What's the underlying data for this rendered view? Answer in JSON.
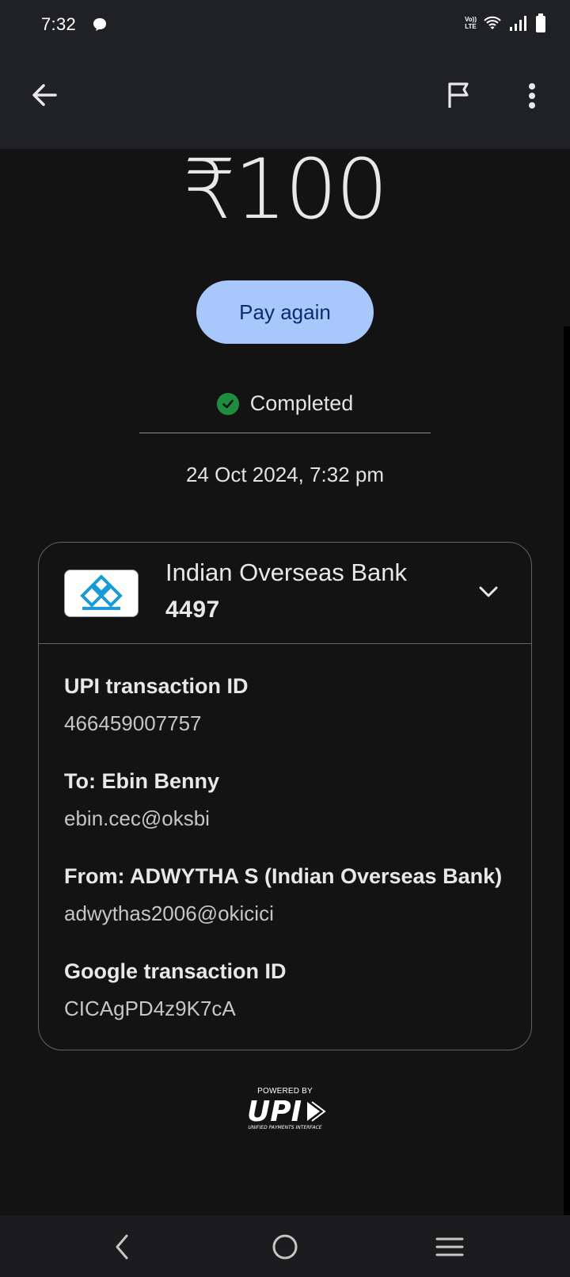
{
  "status_bar": {
    "time": "7:32",
    "volte_top": "Vo))",
    "volte_bottom": "LTE"
  },
  "app_bar": {
    "back_icon": "arrow-left-icon",
    "flag_icon": "flag-icon",
    "more_icon": "more-vert-icon"
  },
  "payment": {
    "amount": "₹100",
    "pay_again_label": "Pay again",
    "status": "Completed",
    "status_color": "#1e8e3e",
    "datetime": "24 Oct 2024, 7:32 pm"
  },
  "card": {
    "bank_name": "Indian Overseas Bank",
    "account_suffix": "4497",
    "details": [
      {
        "label": "UPI transaction ID",
        "value": "466459007757"
      },
      {
        "label": "To: Ebin  Benny",
        "value": "ebin.cec@oksbi"
      },
      {
        "label": "From: ADWYTHA S (Indian Overseas Bank)",
        "value": "adwythas2006@okicici"
      },
      {
        "label": "Google transaction ID",
        "value": "CICAgPD4z9K7cA"
      }
    ]
  },
  "footer": {
    "powered_by": "POWERED BY",
    "upi_text": "UPI",
    "upi_subtext": "UNIFIED PAYMENTS INTERFACE"
  },
  "colors": {
    "accent_button": "#a8c7fa",
    "background": "#131314",
    "bar": "#202124"
  }
}
